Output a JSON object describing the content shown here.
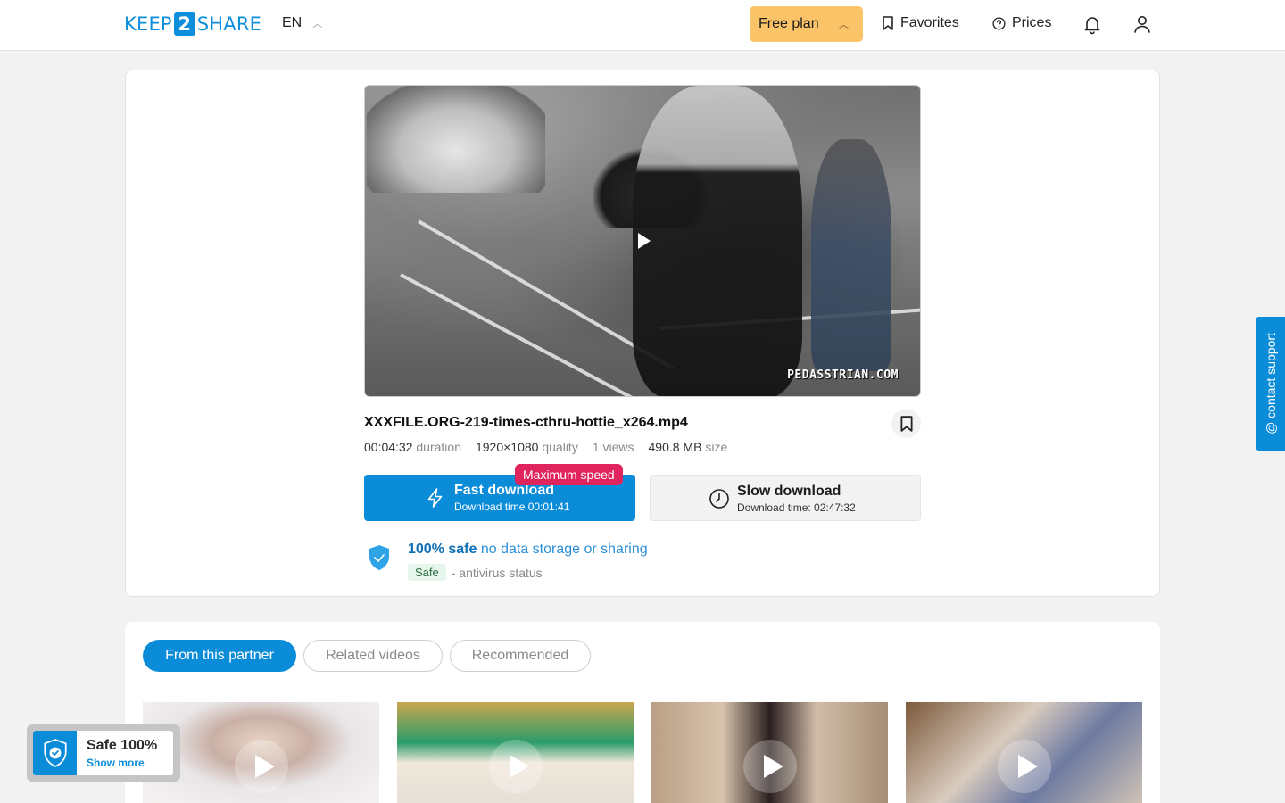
{
  "header": {
    "logo_left": "KEEP",
    "logo_mid": "2",
    "logo_right": "SHARE",
    "language": "EN",
    "plan_label": "Free plan",
    "favorites_label": "Favorites",
    "prices_label": "Prices"
  },
  "file": {
    "video_watermark": "PEDASSTRIAN.COM",
    "name": "XXXFILE.ORG-219-times-cthru-hottie_x264.mp4",
    "duration_value": "00:04:32",
    "duration_unit": "duration",
    "quality_value": "1920×1080",
    "quality_unit": "quality",
    "views": "1 views",
    "size_value": "490.8 MB",
    "size_unit": "size"
  },
  "download": {
    "fast_title": "Fast download",
    "fast_time": "Download time 00:01:41",
    "max_speed_badge": "Maximum speed",
    "slow_title": "Slow download",
    "slow_time": "Download time: 02:47:32"
  },
  "safety": {
    "bold": "100% safe",
    "rest": "no data storage or sharing",
    "badge": "Safe",
    "status": "- antivirus status"
  },
  "tabs": [
    {
      "label": "From this partner",
      "active": true
    },
    {
      "label": "Related videos",
      "active": false
    },
    {
      "label": "Recommended",
      "active": false
    }
  ],
  "widget": {
    "title": "Safe 100%",
    "link": "Show more"
  },
  "support": {
    "label": "@ contact support"
  },
  "colors": {
    "brand_blue": "#0b8cd9",
    "plan_yellow": "#fcc469",
    "badge_red": "#e0245e"
  }
}
